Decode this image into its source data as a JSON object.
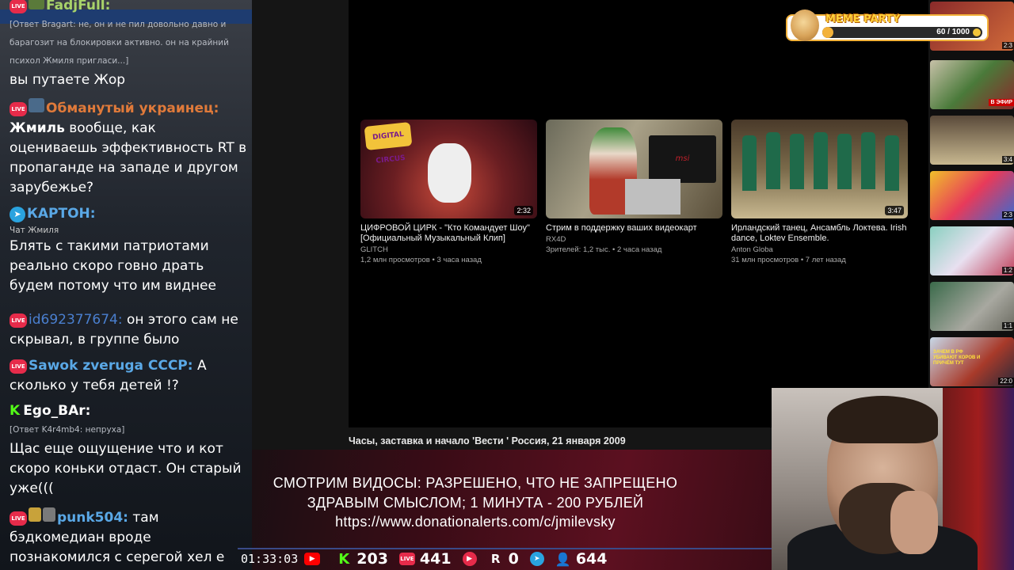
{
  "chat": {
    "messages": [
      {
        "nick": "FadjFull:",
        "nick_color": "#a8d36a",
        "text": ""
      },
      {
        "reply": "[Ответ Bragart: не, он и не пил довольно давно и барагозит на блокировки активно. он на крайний психол Жмиля пригласи...]",
        "text": "вы путаете Жор"
      },
      {
        "nick": "Обманутый украинец:",
        "nick_color": "#e07a3a",
        "text_bold": "Жмиль",
        "text": "вообще, как оцениваешь эффективность RT в пропаганде на западе и другом зарубежье?"
      },
      {
        "nick": "КАРТОН:",
        "nick_color": "#5aa8e6",
        "sub": "Чат Жмиля",
        "text": "Блять с такими патриотами реально скоро говно драть будем потому что им виднее"
      },
      {
        "nick": "id692377674:",
        "nick_color": "#4a7fcf",
        "text": "он этого сам не скрывал, в группе было"
      },
      {
        "nick": "Sawok zveruga CCCP:",
        "nick_color": "#5aa8e6",
        "text": "А сколько у тебя детей !?"
      },
      {
        "nick": "Ego_BAr:",
        "nick_color": "#ffffff",
        "reply": "[Ответ K4r4mb4: непруха]",
        "text": "Щас еще ощущение что и кот скоро коньки отдаст. Он старый уже((("
      },
      {
        "nick": "punk504:",
        "nick_color": "#5aa8e6",
        "text": "там бэдкомедиан вроде познакомился с серегой хел е"
      }
    ],
    "live_label": "LIVE"
  },
  "videos": [
    {
      "title": "ЦИФРОВОЙ ЦИРК - \"Кто Командует Шоу\" [Официальный Музыкальный Клип]",
      "channel": "GLITCH",
      "meta": "1,2 млн просмотров • 3 часа назад",
      "duration": "2:32",
      "thumb_text": "DIGITAL CIRCUS"
    },
    {
      "title": "Стрим в поддержку ваших видеокарт",
      "channel": "RX4D",
      "meta": "Зрителей: 1,2 тыс. • 2 часа назад",
      "duration": "",
      "thumb_text": "msi"
    },
    {
      "title": "Ирландский танец, Ансамбль Локтева. Irish dance, Loktev Ensemble.",
      "channel": "Anton Globa",
      "meta": "31 млн просмотров • 7 лет назад",
      "duration": "3:47",
      "thumb_text": ""
    }
  ],
  "current_video_title": "Часы, заставка и начало 'Вести ' Россия, 21 января 2009",
  "sidebar_thumbs": [
    {
      "duration": "2:3"
    },
    {
      "live": "В ЭФИР"
    },
    {
      "duration": "3:4"
    },
    {
      "duration": "2:3"
    },
    {
      "duration": "1:2"
    },
    {
      "duration": "1:1"
    },
    {
      "duration": "22:0",
      "caption": "ЗАЧЕМ В РФ УБИВАЮТ КОРОВ И ПРИЧЁМ ТУТ"
    }
  ],
  "meme_party": {
    "title": "MEME PARTY",
    "progress": "60 / 1000",
    "fraction": 0.06
  },
  "donation_banner": {
    "line1": "СМОТРИМ ВИДОСЫ: РАЗРЕШЕНО, ЧТО НЕ ЗАПРЕЩЕНО",
    "line2": "ЗДРАВЫМ СМЫСЛОМ; 1 МИНУТА - 200 РУБЛЕЙ",
    "line3": "https://www.donationalerts.com/c/jmilevsky"
  },
  "stats": {
    "uptime": "01:33:03",
    "kick": "203",
    "vk_live": "441",
    "rutube": "0",
    "total": "644"
  },
  "colors": {
    "live_red": "#e62b4a",
    "telegram": "#2aa3df",
    "kick_green": "#53fc18",
    "youtube_red": "#ff0000",
    "banner": "#5c1020"
  }
}
